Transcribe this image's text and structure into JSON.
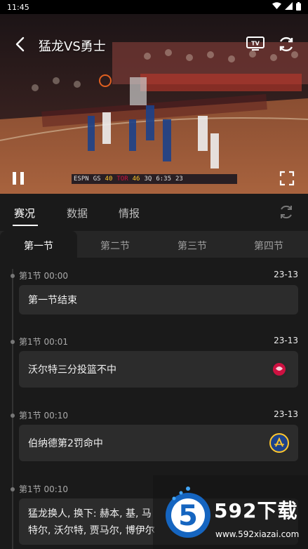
{
  "status_bar": {
    "time": "11:45"
  },
  "video": {
    "title": "猛龙VS勇士",
    "scoreboard": {
      "net": "ESPN",
      "team1": "GS",
      "score1": "40",
      "team2": "TOR",
      "score2": "46",
      "period": "3Q",
      "clock": "6:35",
      "shot": "23"
    }
  },
  "tabs": [
    {
      "label": "赛况",
      "active": true
    },
    {
      "label": "数据",
      "active": false
    },
    {
      "label": "情报",
      "active": false
    }
  ],
  "periods": [
    {
      "label": "第一节",
      "active": true
    },
    {
      "label": "第二节",
      "active": false
    },
    {
      "label": "第三节",
      "active": false
    },
    {
      "label": "第四节",
      "active": false
    }
  ],
  "events": [
    {
      "meta": "第1节 00:00",
      "score": "23-13",
      "text": "第一节结束",
      "team": ""
    },
    {
      "meta": "第1节 00:01",
      "score": "23-13",
      "text": "沃尔特三分投篮不中",
      "team": "raptors"
    },
    {
      "meta": "第1节 00:10",
      "score": "23-13",
      "text": "伯纳德第2罚命中",
      "team": "warriors"
    },
    {
      "meta": "第1节 00:10",
      "score": "",
      "text": "猛龙换人, 换下: 赫本, 基, 马",
      "text2": "特尔, 沃尔特, 贾马尔, 博伊尔",
      "team": ""
    }
  ],
  "watermark": {
    "brand": "592下载",
    "url": "www.592xiazai.com"
  },
  "colors": {
    "raptors_red": "#ce1141",
    "warriors_blue": "#1d428a",
    "warriors_gold": "#ffc72c"
  }
}
